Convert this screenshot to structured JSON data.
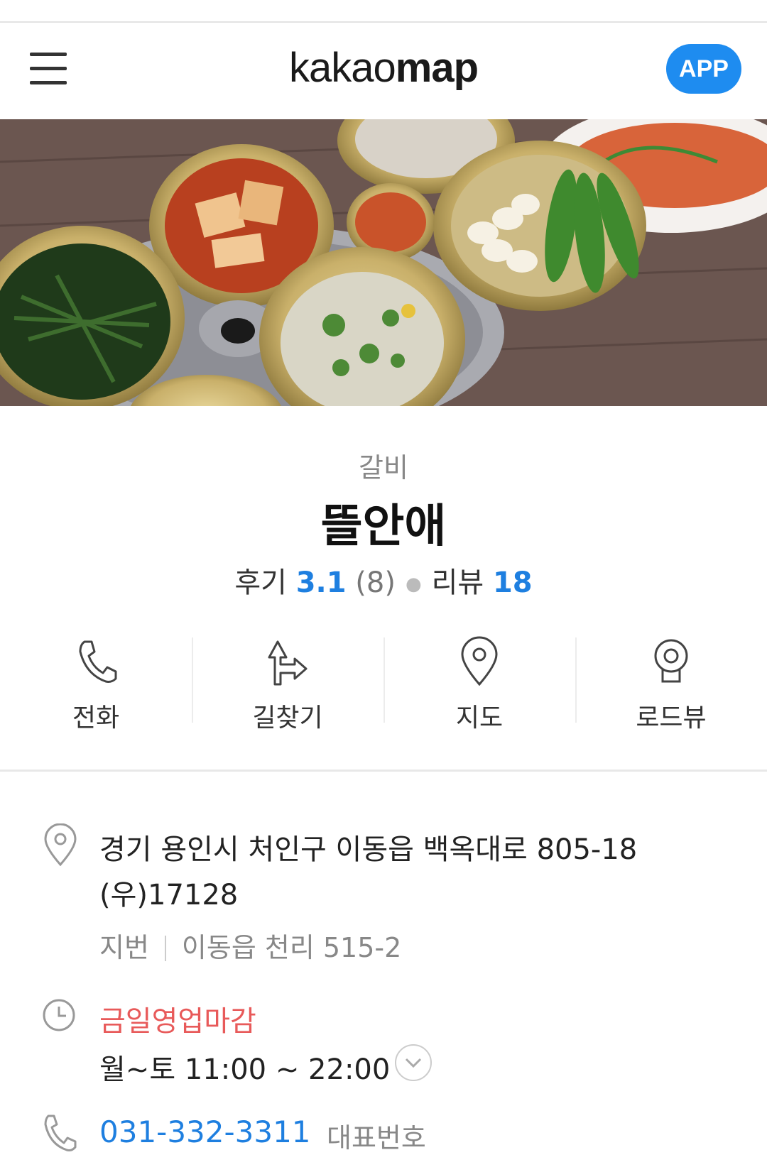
{
  "header": {
    "logo_light": "kakao",
    "logo_bold": "map",
    "app_button": "APP"
  },
  "hero": {
    "description": "side dishes photo"
  },
  "place": {
    "category": "갈비",
    "name": "뜰안애",
    "review_label": "후기",
    "review_score": "3.1",
    "review_count": "(8)",
    "blog_label": "리뷰",
    "blog_count": "18"
  },
  "actions": [
    {
      "label": "전화",
      "icon": "phone-icon"
    },
    {
      "label": "길찾기",
      "icon": "directions-icon"
    },
    {
      "label": "지도",
      "icon": "map-pin-icon"
    },
    {
      "label": "로드뷰",
      "icon": "roadview-icon"
    }
  ],
  "details": {
    "address": "경기 용인시 처인구 이동읍 백옥대로 805-18",
    "postal": "(우)17128",
    "jibun_label": "지번",
    "jibun_address": "이동읍 천리 515-2",
    "status": "금일영업마감",
    "hours": "월~토 11:00 ~ 22:00",
    "phone": "031-332-3311",
    "phone_type": "대표번호"
  },
  "colors": {
    "accent": "#1e7fe0",
    "app_button": "#1e8cf0",
    "closed": "#e85a5a"
  }
}
